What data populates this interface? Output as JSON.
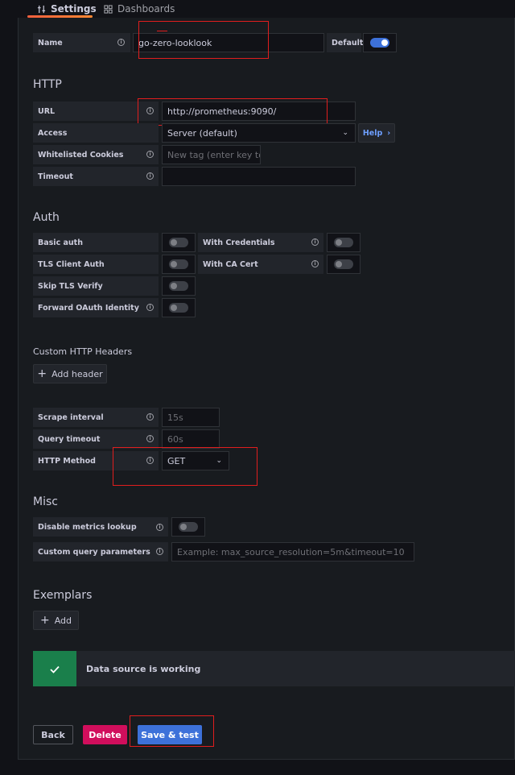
{
  "tabs": [
    {
      "label": "Settings",
      "icon": "sliders-icon"
    },
    {
      "label": "Dashboards",
      "icon": "dashboards-grid-icon"
    }
  ],
  "name_row": {
    "label": "Name",
    "value": "go-zero-looklook",
    "default_label": "Default",
    "default_on": true
  },
  "http": {
    "title": "HTTP",
    "url_label": "URL",
    "url_value": "http://prometheus:9090/",
    "access_label": "Access",
    "access_value": "Server (default)",
    "help_label": "Help",
    "cookies_label": "Whitelisted Cookies",
    "cookies_placeholder": "New tag (enter key to ac",
    "timeout_label": "Timeout",
    "timeout_value": ""
  },
  "auth": {
    "title": "Auth",
    "basic_auth": "Basic auth",
    "with_credentials": "With Credentials",
    "tls_client_auth": "TLS Client Auth",
    "with_ca_cert": "With CA Cert",
    "skip_tls_verify": "Skip TLS Verify",
    "forward_oauth": "Forward OAuth Identity"
  },
  "headers": {
    "title": "Custom HTTP Headers",
    "add_label": "Add header"
  },
  "prometheus": {
    "scrape_label": "Scrape interval",
    "scrape_placeholder": "15s",
    "query_timeout_label": "Query timeout",
    "query_timeout_placeholder": "60s",
    "method_label": "HTTP Method",
    "method_value": "GET"
  },
  "misc": {
    "title": "Misc",
    "disable_metrics_label": "Disable metrics lookup",
    "custom_params_label": "Custom query parameters",
    "custom_params_placeholder": "Example: max_source_resolution=5m&timeout=10"
  },
  "exemplars": {
    "title": "Exemplars",
    "add_label": "Add"
  },
  "status": {
    "message": "Data source is working",
    "color": "#1a7f4b"
  },
  "actions": {
    "back": "Back",
    "delete": "Delete",
    "save": "Save & test"
  },
  "colors": {
    "primary": "#3d71d9",
    "danger": "#d10e5c",
    "success": "#1a7f4b",
    "highlight": "#e01e1e"
  }
}
